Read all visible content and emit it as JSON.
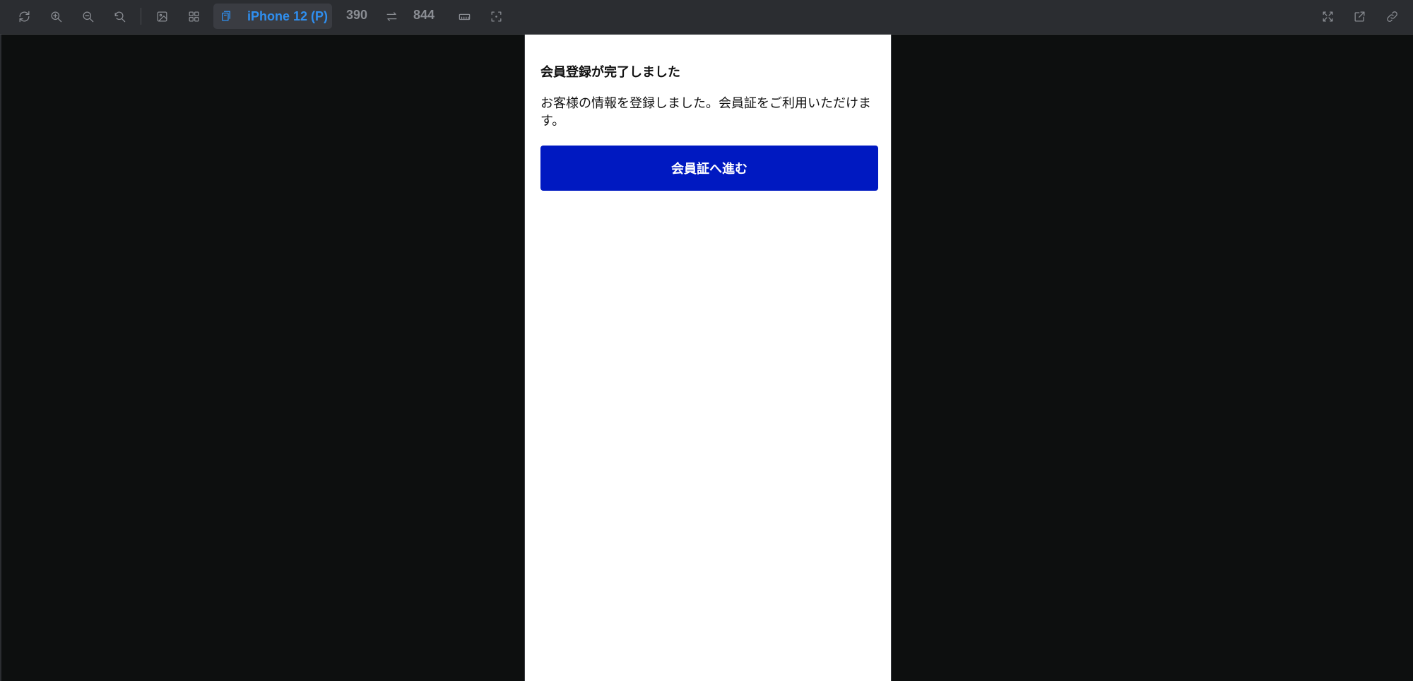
{
  "toolbar": {
    "left_icons": [
      "rotate-icon",
      "zoom-in-icon",
      "zoom-out-icon",
      "reset-zoom-icon",
      "image-icon",
      "grid-icon"
    ],
    "device": {
      "icon": "device-frame-icon",
      "label": "iPhone 12 (P)"
    },
    "width": "390",
    "swap_icon": "swap-dimensions-icon",
    "height": "844",
    "after_icons": [
      "ruler-icon",
      "crop-frame-icon"
    ],
    "right_icons": [
      "fullscreen-icon",
      "open-external-icon",
      "copy-link-icon"
    ],
    "accent_color": "#2f8ff0"
  },
  "page": {
    "title": "会員登録が完了しました",
    "body": "お客様の情報を登録しました。会員証をご利用いただけます。",
    "button_label": "会員証へ進む",
    "button_color": "#0019c1"
  }
}
